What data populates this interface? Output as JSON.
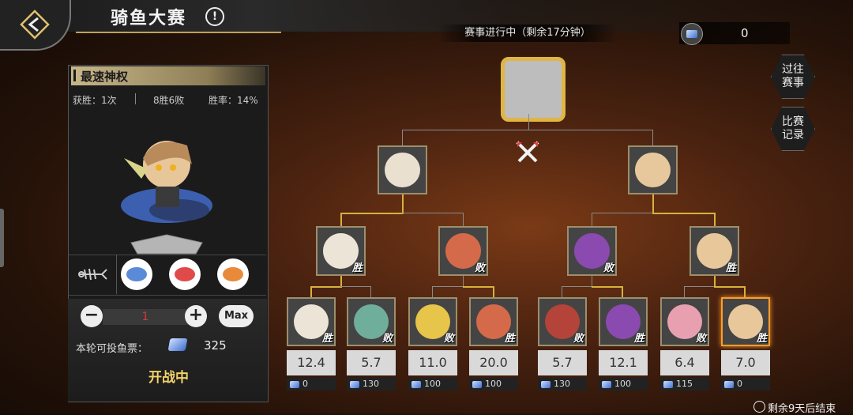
{
  "header": {
    "title": "骑鱼大赛",
    "info_icon": "!"
  },
  "panel": {
    "title": "最速神权",
    "wins_label": "获胜：1次",
    "record": "8胜6败",
    "win_rate": "胜率：14%"
  },
  "bet": {
    "minus": "−",
    "plus": "+",
    "value": "1",
    "max_label": "Max",
    "vote_label": "本轮可投鱼票：",
    "vote_count": "325",
    "status": "开战中"
  },
  "tournament": {
    "status_text": "赛事进行中（剩余17分钟）",
    "semis": [
      {
        "face": "#e9e0d0"
      },
      {
        "face": "#e6c89c"
      }
    ],
    "quarters": [
      {
        "result": "胜",
        "face": "#ece4d6"
      },
      {
        "result": "败",
        "face": "#d46a4a"
      },
      {
        "result": "败",
        "face": "#8a4ab0"
      },
      {
        "result": "胜",
        "face": "#e8c79a"
      }
    ],
    "first_round": [
      {
        "result": "胜",
        "odds": "12.4",
        "bets": "0",
        "face": "#ece4d6"
      },
      {
        "result": "败",
        "odds": "5.7",
        "bets": "130",
        "face": "#6fae9a"
      },
      {
        "result": "败",
        "odds": "11.0",
        "bets": "100",
        "face": "#e7c44a"
      },
      {
        "result": "胜",
        "odds": "20.0",
        "bets": "100",
        "face": "#d46a4a"
      },
      {
        "result": "败",
        "odds": "5.7",
        "bets": "130",
        "face": "#b4433a"
      },
      {
        "result": "胜",
        "odds": "12.1",
        "bets": "100",
        "face": "#8a4ab0"
      },
      {
        "result": "败",
        "odds": "6.4",
        "bets": "115",
        "face": "#e8a0b0"
      },
      {
        "result": "胜",
        "odds": "7.0",
        "bets": "0",
        "face": "#e8c79a"
      }
    ]
  },
  "currency": {
    "value": "0"
  },
  "side_buttons": {
    "past": "过往\n赛事",
    "records": "比赛\n记录"
  },
  "footer": {
    "remaining": "剩余9天后结束"
  },
  "colors": {
    "gold": "#d8b13a",
    "accent_orange": "#ff9c2a",
    "panel_title": "#c8b78a"
  }
}
